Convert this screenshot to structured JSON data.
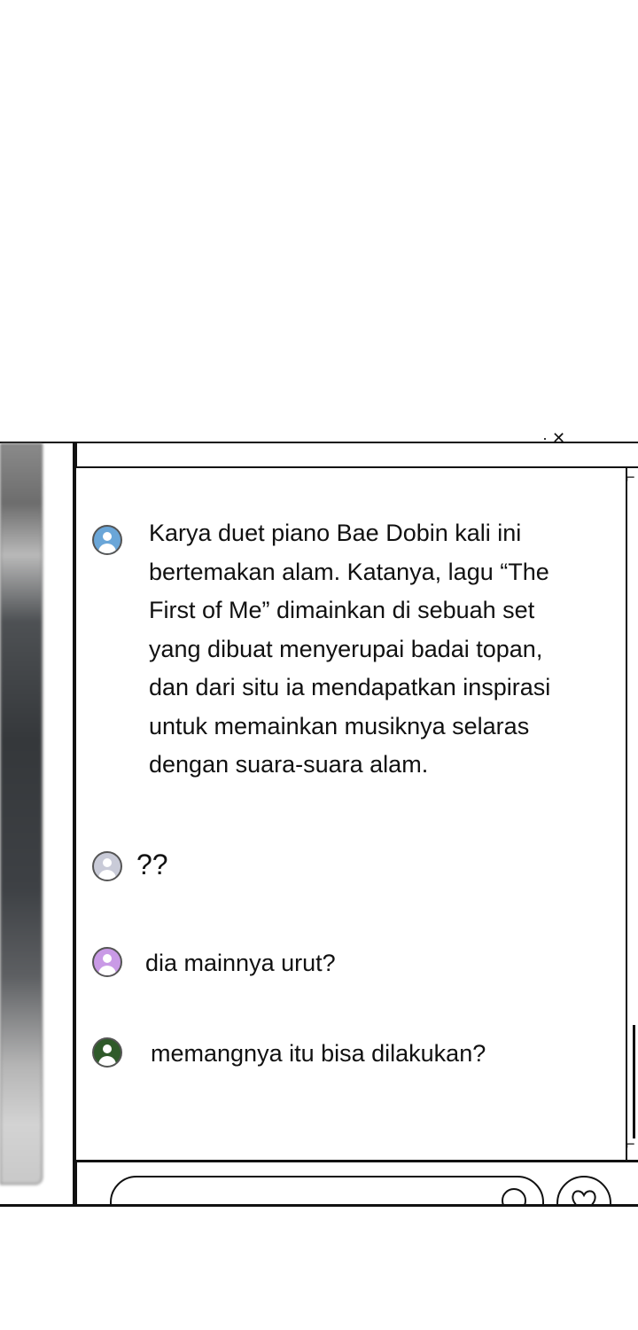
{
  "messages": [
    {
      "avatar_color": "#6aa6d8",
      "avatar_icon": "user-icon",
      "text": "Karya duet piano Bae Dobin kali ini\nbertemakan alam. Katanya, lagu “The\nFirst of Me” dimainkan di sebuah set\nyang dibuat menyerupai badai topan,\ndan dari situ ia mendapatkan inspirasi\nuntuk memainkan musiknya selaras\ndengan suara-suara alam."
    },
    {
      "avatar_color": "#c9cbd8",
      "avatar_icon": "user-icon",
      "text": "??"
    },
    {
      "avatar_color": "#c99ae6",
      "avatar_icon": "user-icon",
      "text": "dia mainnya urut?"
    },
    {
      "avatar_color": "#2f5a2a",
      "avatar_icon": "user-icon",
      "text": "memangnya itu bisa dilakukan?"
    }
  ],
  "input": {
    "emoji_icon": "smile-icon",
    "heart_icon": "heart-icon"
  }
}
